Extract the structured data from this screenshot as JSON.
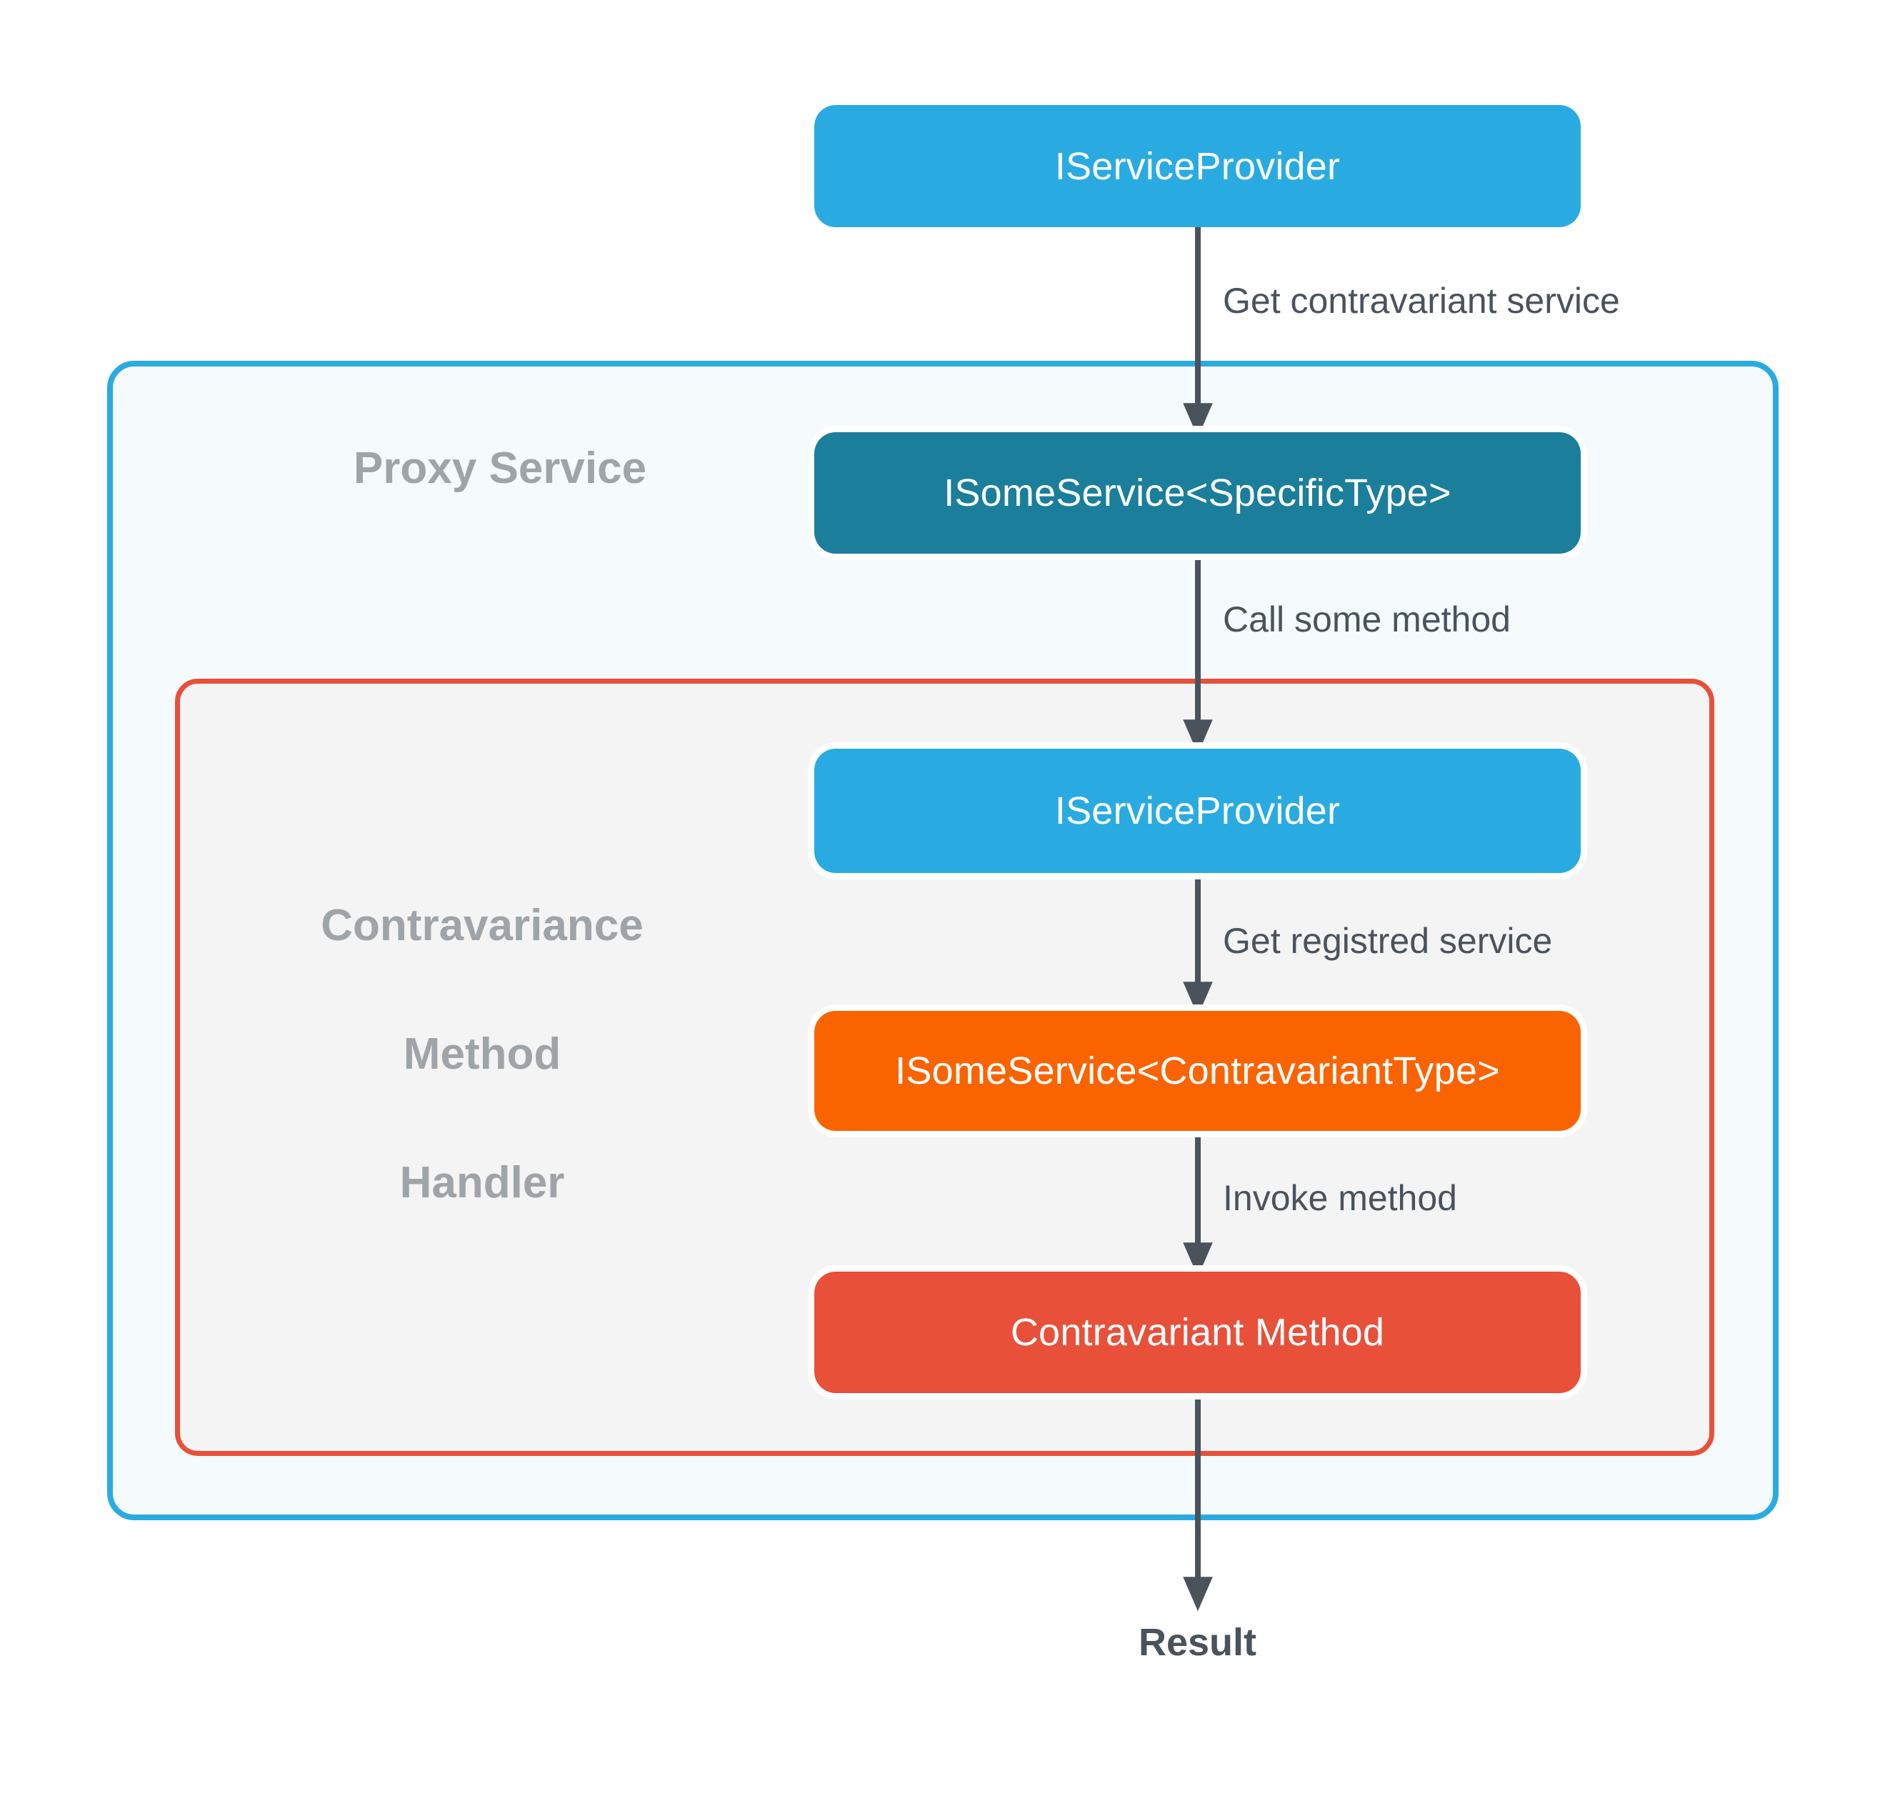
{
  "diagram": {
    "title_nodes": {
      "service_provider_top": "IServiceProvider",
      "some_service_specific": "ISomeService<SpecificType>",
      "service_provider_inner": "IServiceProvider",
      "some_service_contravariant": "ISomeService<ContravariantType>",
      "contravariant_method": "Contravariant Method"
    },
    "containers": {
      "proxy_service_label": "Proxy Service",
      "handler_label_line1": "Contravariance",
      "handler_label_line2": "Method",
      "handler_label_line3": "Handler"
    },
    "edges": {
      "get_contravariant_service": "Get contravariant service",
      "call_some_method": "Call some method",
      "get_registered_service": "Get registred service",
      "invoke_method": "Invoke method"
    },
    "terminal": {
      "result": "Result"
    },
    "colors": {
      "sky_blue": "#29ABE2",
      "teal": "#1B7E9B",
      "orange": "#FA6400",
      "red": "#E8503A",
      "outer_border": "#29ABE2",
      "outer_fill": "#F5FAFD",
      "inner_border": "#E8503A",
      "inner_fill": "#F4F4F5",
      "arrow": "#4A535C",
      "group_label": "#9EA4A8",
      "edge_label": "#4A535C"
    }
  }
}
